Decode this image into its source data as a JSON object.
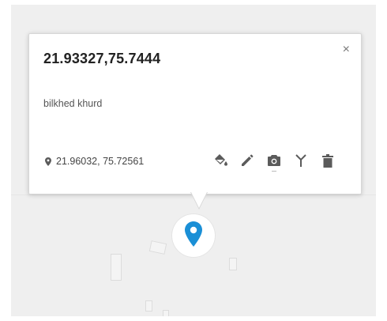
{
  "popup": {
    "title": "21.93327,75.7444",
    "description": "bilkhed khurd",
    "location_coords": "21.96032, 75.72561",
    "close_label": "×",
    "tools": [
      {
        "name": "fill-color-icon"
      },
      {
        "name": "edit-icon"
      },
      {
        "name": "camera-icon"
      },
      {
        "name": "route-icon"
      },
      {
        "name": "delete-icon"
      }
    ]
  },
  "colors": {
    "marker_blue": "#1a8fd6",
    "tool_gray": "#5b5b5b",
    "map_bg": "#efefef"
  }
}
